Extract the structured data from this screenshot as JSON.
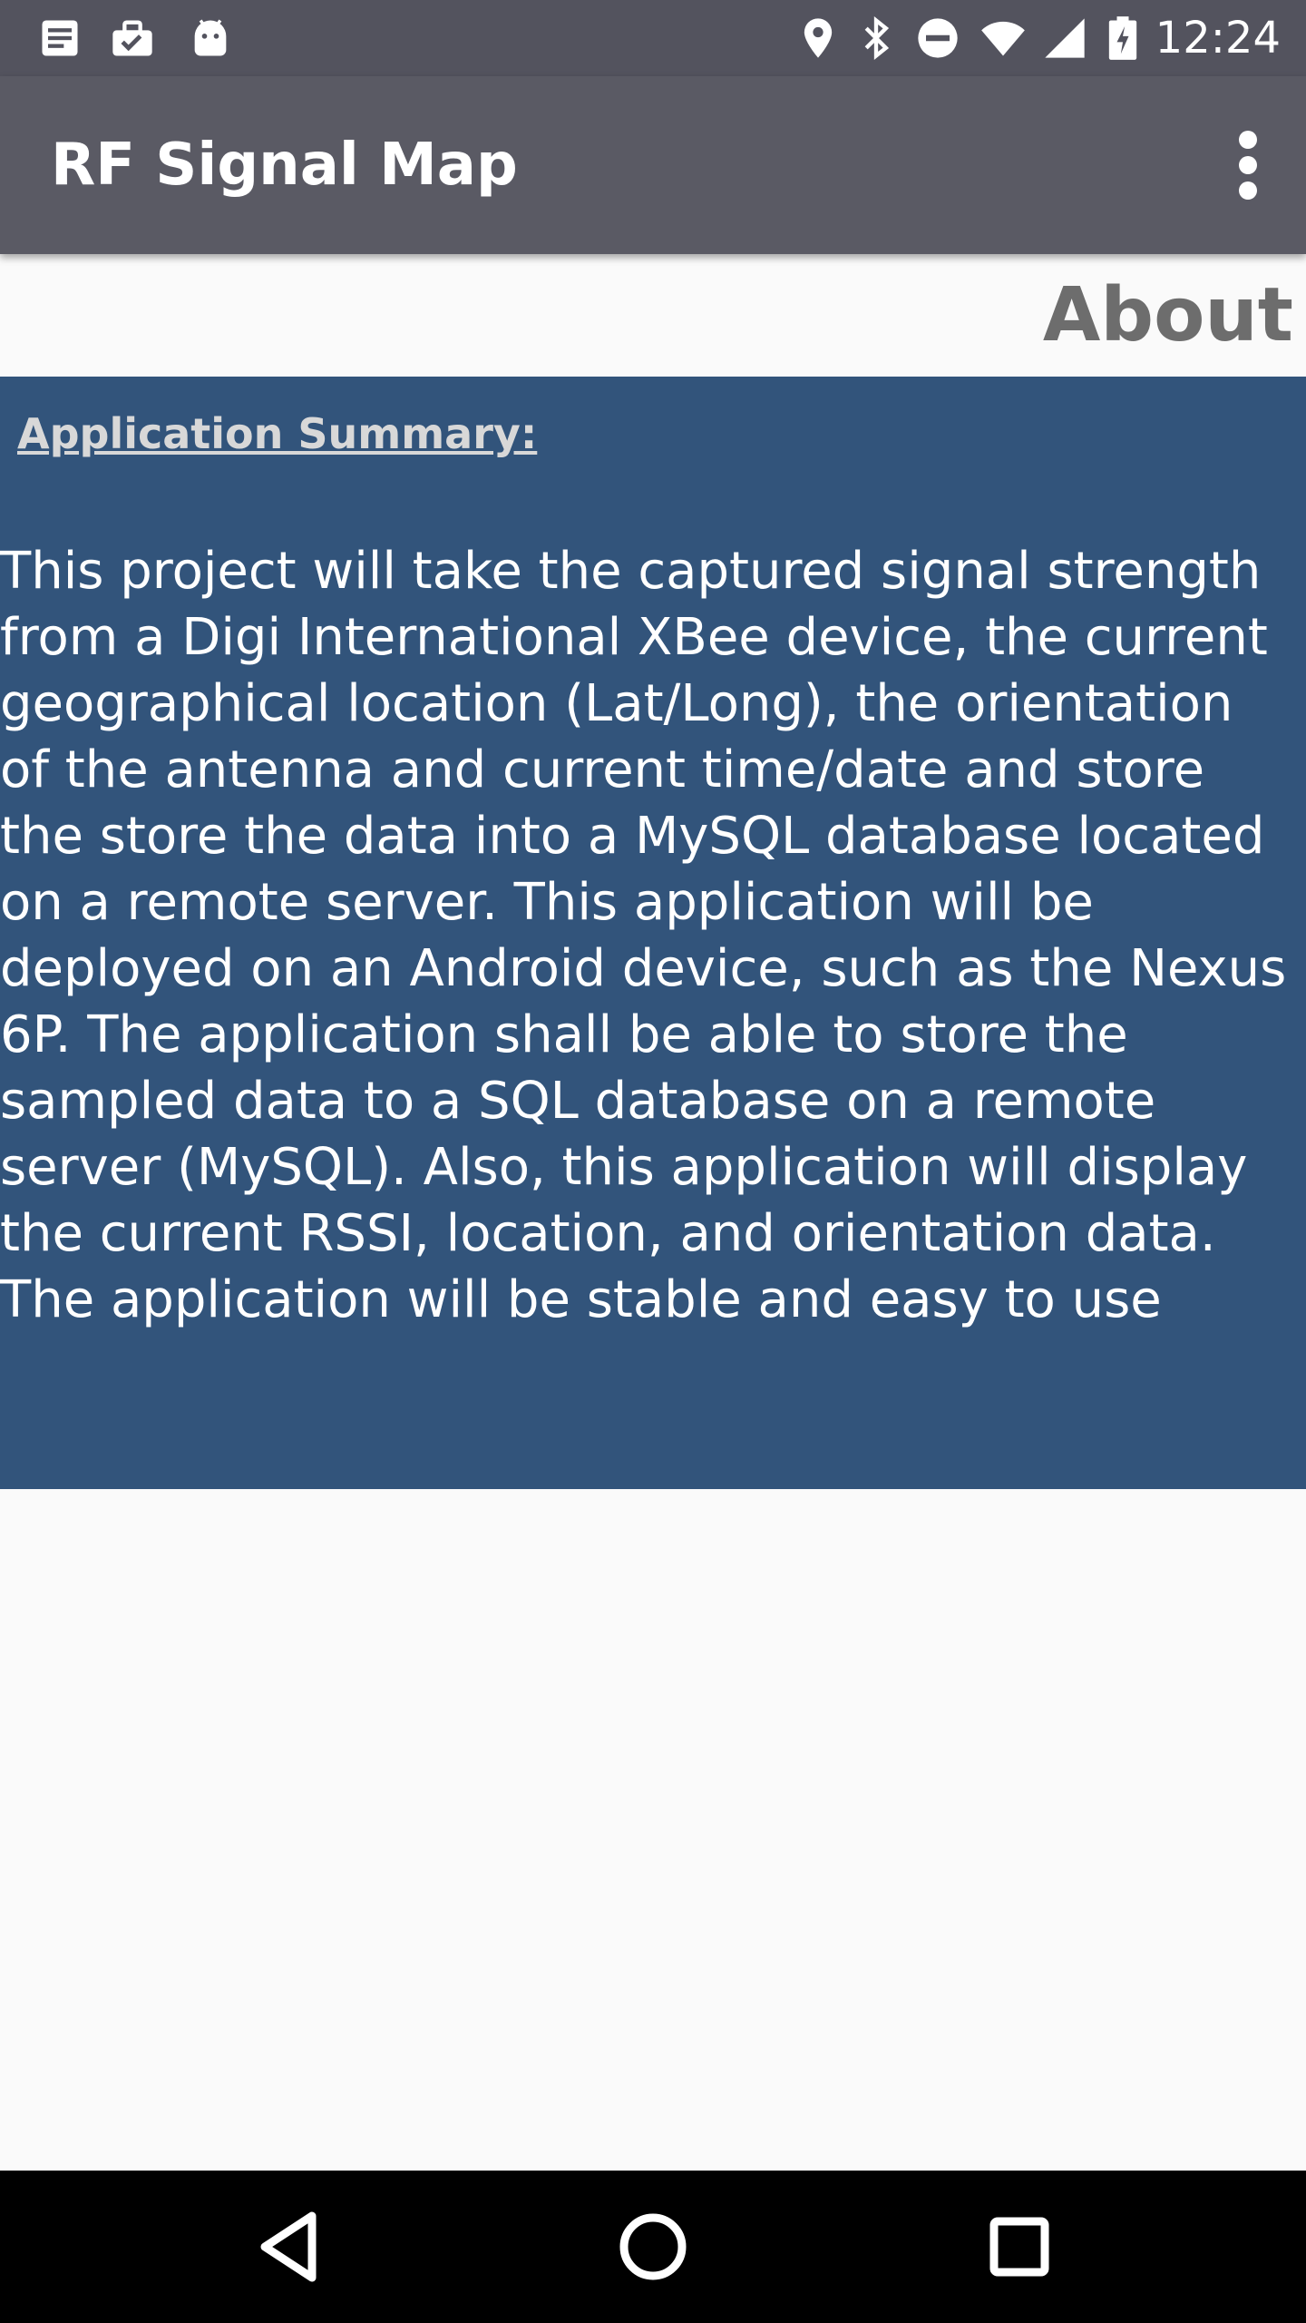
{
  "status_bar": {
    "time": "12:24",
    "left_icons": [
      "notes-icon",
      "briefcase-check-icon",
      "android-icon"
    ],
    "right_icons": [
      "location-icon",
      "bluetooth-icon",
      "do-not-disturb-icon",
      "wifi-icon",
      "signal-icon",
      "battery-charging-icon"
    ]
  },
  "app_bar": {
    "title": "RF Signal Map",
    "menu_icon": "more-vert-icon"
  },
  "page": {
    "title": "About"
  },
  "summary": {
    "heading": "Application Summary:",
    "body": "This project will take the captured signal strength from a Digi International XBee device, the current geographical location (Lat/Long), the orientation of the antenna and current time/date and store the store the data into a MySQL database located on a remote server. This application will be deployed on an Android device, such as the Nexus 6P. The application shall be able to store the sampled data to a SQL database on a remote server (MySQL). Also, this application will display the current RSSI, location, and orientation data. The application will be stable and easy to use"
  },
  "nav_bar": {
    "back_icon": "back-icon",
    "home_icon": "home-icon",
    "recents_icon": "recents-icon"
  },
  "colors": {
    "status_bar": "#53535e",
    "app_bar": "#5a5a64",
    "content_panel": "#32547b",
    "page_title": "#6d6d6d",
    "background": "#fafafa"
  }
}
